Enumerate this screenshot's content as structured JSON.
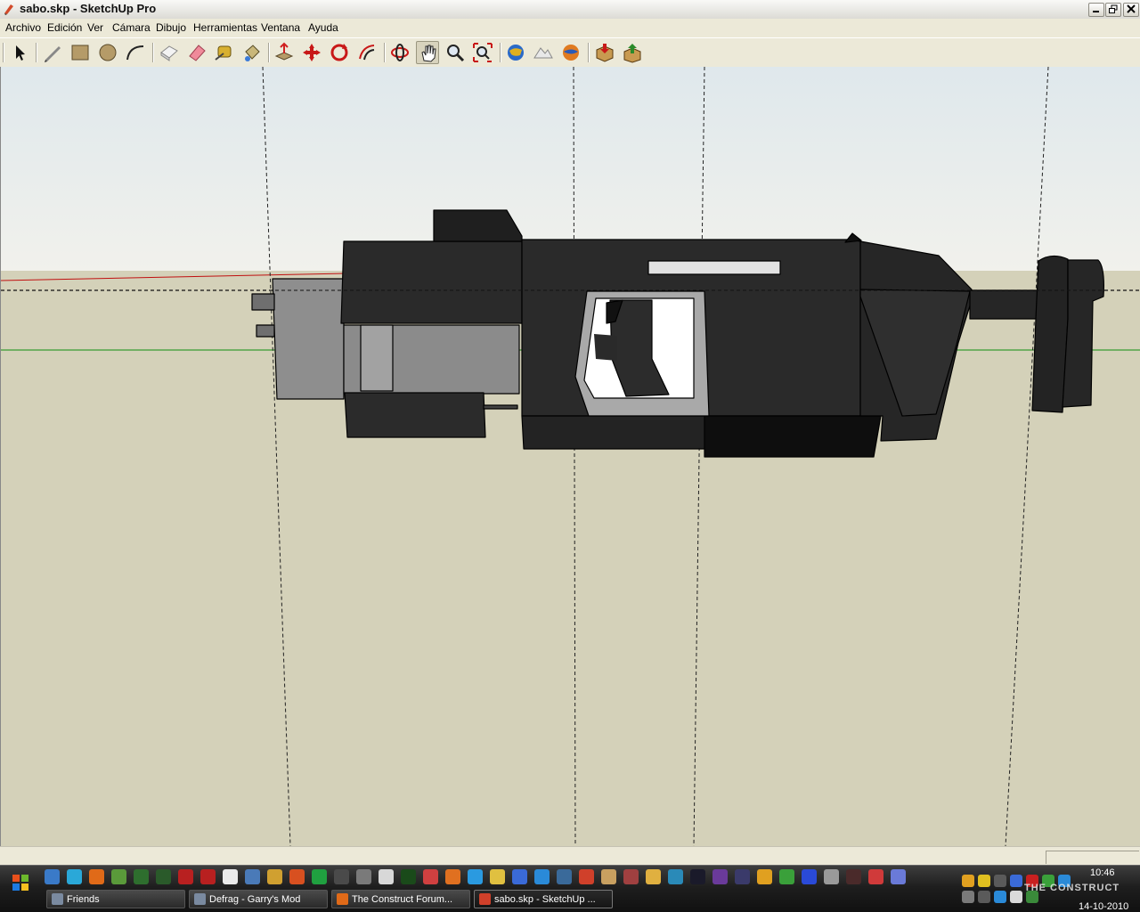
{
  "window": {
    "title": "sabo.skp - SketchUp Pro",
    "controls": [
      "minimize",
      "maximize",
      "close"
    ]
  },
  "menu": [
    "Archivo",
    "Edición",
    "Ver",
    "Cámara",
    "Dibujo",
    "Herramientas",
    "Ventana",
    "Ayuda"
  ],
  "toolbar": {
    "tools": [
      {
        "name": "select",
        "icon": "select-arrow-icon",
        "active": false
      },
      {
        "name": "line",
        "icon": "pencil-icon",
        "active": false
      },
      {
        "name": "rectangle",
        "icon": "rectangle-icon",
        "active": false
      },
      {
        "name": "circle",
        "icon": "circle-icon",
        "active": false
      },
      {
        "name": "arc",
        "icon": "arc-icon",
        "active": false
      },
      {
        "name": "make-component",
        "icon": "component-icon",
        "active": false
      },
      {
        "name": "eraser",
        "icon": "eraser-icon",
        "active": false
      },
      {
        "name": "tape-measure",
        "icon": "tape-measure-icon",
        "active": false
      },
      {
        "name": "paint-bucket",
        "icon": "paint-bucket-icon",
        "active": false
      },
      {
        "name": "push-pull",
        "icon": "push-pull-icon",
        "active": false
      },
      {
        "name": "move",
        "icon": "move-icon",
        "active": false
      },
      {
        "name": "rotate",
        "icon": "rotate-icon",
        "active": false
      },
      {
        "name": "offset",
        "icon": "offset-icon",
        "active": false
      },
      {
        "name": "orbit",
        "icon": "orbit-icon",
        "active": false
      },
      {
        "name": "pan",
        "icon": "pan-hand-icon",
        "active": true
      },
      {
        "name": "zoom",
        "icon": "zoom-icon",
        "active": false
      },
      {
        "name": "zoom-extents",
        "icon": "zoom-extents-icon",
        "active": false
      },
      {
        "name": "get-current-view",
        "icon": "globe-view-icon",
        "active": false
      },
      {
        "name": "toggle-terrain",
        "icon": "terrain-icon",
        "active": false
      },
      {
        "name": "place-model",
        "icon": "earth-place-icon",
        "active": false
      },
      {
        "name": "get-models",
        "icon": "get-models-icon",
        "active": false
      },
      {
        "name": "share-model",
        "icon": "share-model-icon",
        "active": false
      }
    ]
  },
  "viewport": {
    "sky_color": "#dde6ea",
    "ground_color": "#d4d1b9",
    "model_color": "#2a2a2a",
    "axis_colors": {
      "red": "#c01010",
      "green": "#109010"
    }
  },
  "taskbar": {
    "tasks": [
      {
        "label": "Friends",
        "icon": "steam-icon",
        "active": false
      },
      {
        "label": "Defrag - Garry's Mod",
        "icon": "steam-icon",
        "active": false
      },
      {
        "label": "The Construct Forum...",
        "icon": "firefox-icon",
        "active": false
      },
      {
        "label": "sabo.skp - SketchUp ...",
        "icon": "sketchup-icon",
        "active": true
      }
    ],
    "clock_time": "10:46",
    "clock_date": "14-10-2010",
    "watermark": "THE CONSTRUCT"
  }
}
